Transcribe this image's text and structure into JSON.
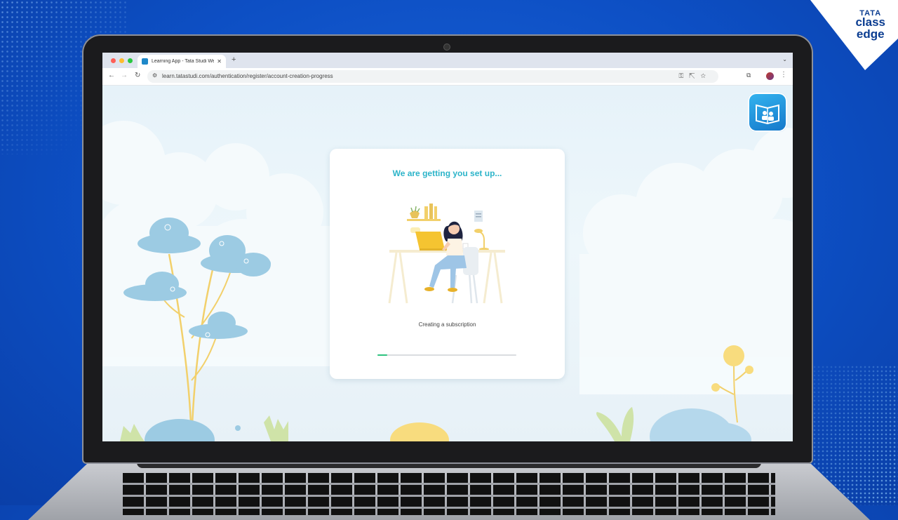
{
  "brand": {
    "line1": "TATA",
    "line2": "class",
    "line3": "edge"
  },
  "browser": {
    "tab_title": "Learning App - Tata Studi We",
    "new_tab": "+",
    "url": "learn.tatastudi.com/authentication/register/account-creation-progress"
  },
  "setup": {
    "title": "We are getting you set up...",
    "status": "Creating a subscription",
    "progress": 0.07
  },
  "colors": {
    "accent": "#2cb4c9",
    "progress": "#2ec27e",
    "page_bg": "#e9f3f8"
  },
  "icons": [
    "back-arrow-icon",
    "forward-arrow-icon",
    "reload-icon",
    "site-settings-icon",
    "key-icon",
    "share-icon",
    "star-icon",
    "extensions-icon",
    "more-icon"
  ]
}
